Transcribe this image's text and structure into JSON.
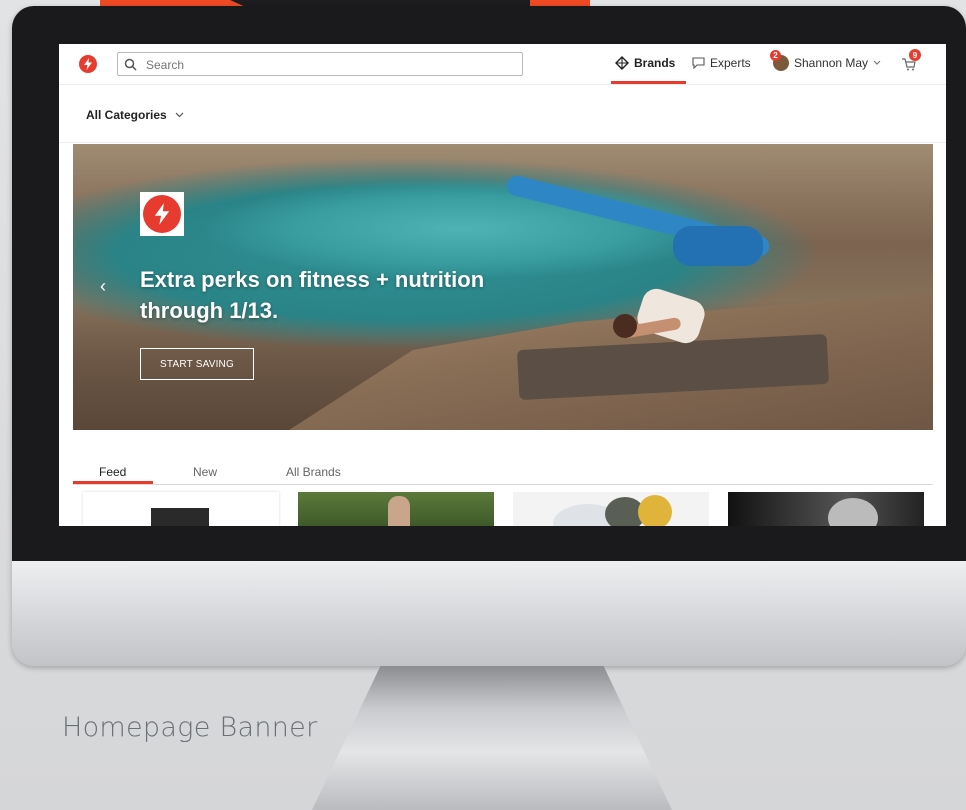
{
  "header": {
    "search_placeholder": "Search",
    "nav_brands": "Brands",
    "nav_experts": "Experts",
    "user_name": "Shannon May",
    "user_badge": "2",
    "cart_badge": "9"
  },
  "category_bar": {
    "label": "All Categories"
  },
  "hero": {
    "title": "Extra perks on fitness + nutrition through 1/13.",
    "button_label": "START SAVING"
  },
  "tabs": [
    "Feed",
    "New",
    "All Brands"
  ],
  "caption": "Homepage Banner",
  "colors": {
    "accent": "#e63b2e",
    "caption": "#6b6f76"
  }
}
